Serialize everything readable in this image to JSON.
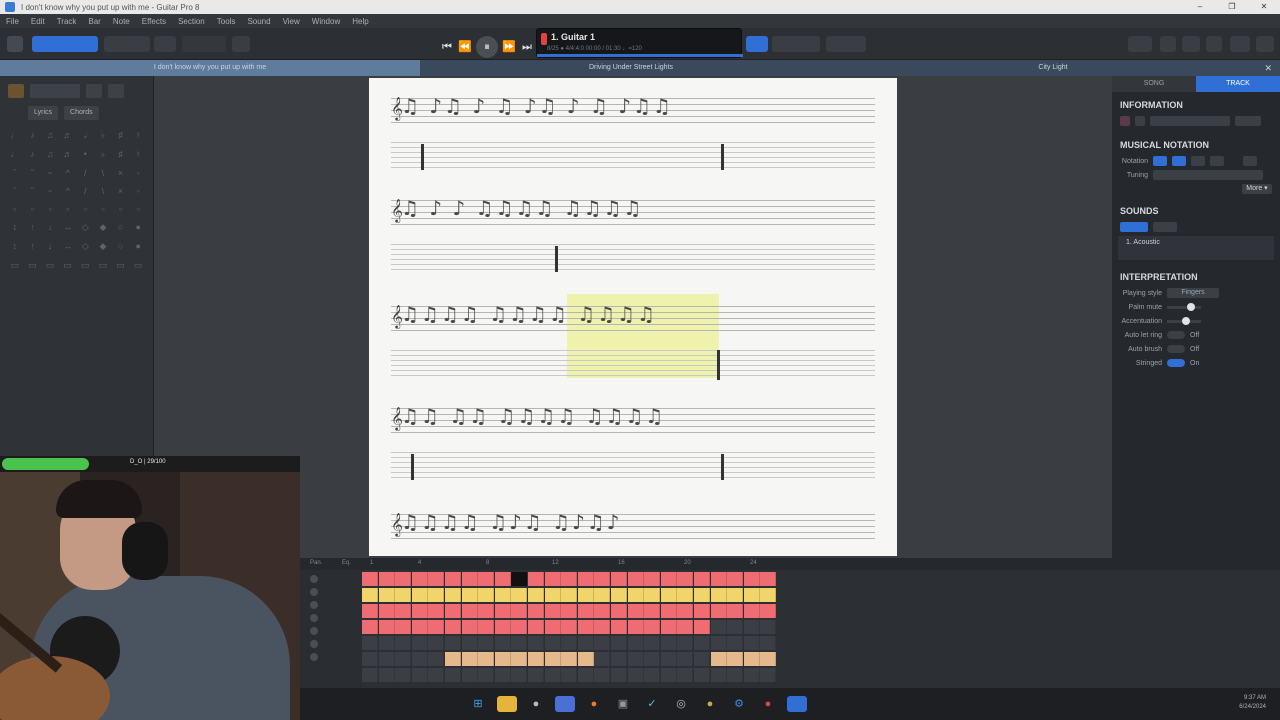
{
  "window": {
    "title": "I don't know why you put up with me - Guitar Pro 8",
    "controls": [
      "–",
      "❐",
      "✕"
    ]
  },
  "menu": [
    "File",
    "Edit",
    "Track",
    "Bar",
    "Note",
    "Effects",
    "Section",
    "Tools",
    "Sound",
    "View",
    "Window",
    "Help"
  ],
  "lcd": {
    "track": "1. Guitar 1",
    "info": "8/25   ● 4/4:4:0   00:00 / 01:30   ♩=120"
  },
  "tabs": [
    {
      "label": "I don't know why you put up with me",
      "active": true
    },
    {
      "label": "Driving Under Street Lights",
      "active": false
    },
    {
      "label": "City Light",
      "active": false
    }
  ],
  "left_panel": {
    "lyrics_label": "Lyrics",
    "chords_label": "Chords"
  },
  "right_panel": {
    "tab_song": "SONG",
    "tab_track": "TRACK",
    "information": "INFORMATION",
    "musical_notation": "MUSICAL NOTATION",
    "notation_label": "Notation",
    "tuning_label": "Tuning",
    "more_label": "More ▾",
    "sounds": "SOUNDS",
    "sound_name": "1. Acoustic",
    "interpretation": "INTERPRETATION",
    "playing_style_label": "Playing style",
    "playing_style_value": "Fingers",
    "palm_mute_label": "Palm mute",
    "palm_mute_value": 0.7,
    "accentuation_label": "Accentuation",
    "accentuation_value": 0.55,
    "auto_let_ring_label": "Auto let ring",
    "auto_let_ring_value": "Off",
    "auto_brush_label": "Auto brush",
    "auto_brush_value": "Off",
    "stringed_label": "Stringed",
    "stringed_value": "On"
  },
  "webcam": {
    "label": "D_O | 29/100",
    "progress": 0.29
  },
  "tracks": {
    "pan_label": "Pan.",
    "eq_label": "Eq.",
    "ruler": [
      "1",
      "4",
      "8",
      "12",
      "16",
      "20",
      "24"
    ]
  },
  "taskbar": {
    "time": "9:37 AM",
    "date": "6/24/2024"
  }
}
